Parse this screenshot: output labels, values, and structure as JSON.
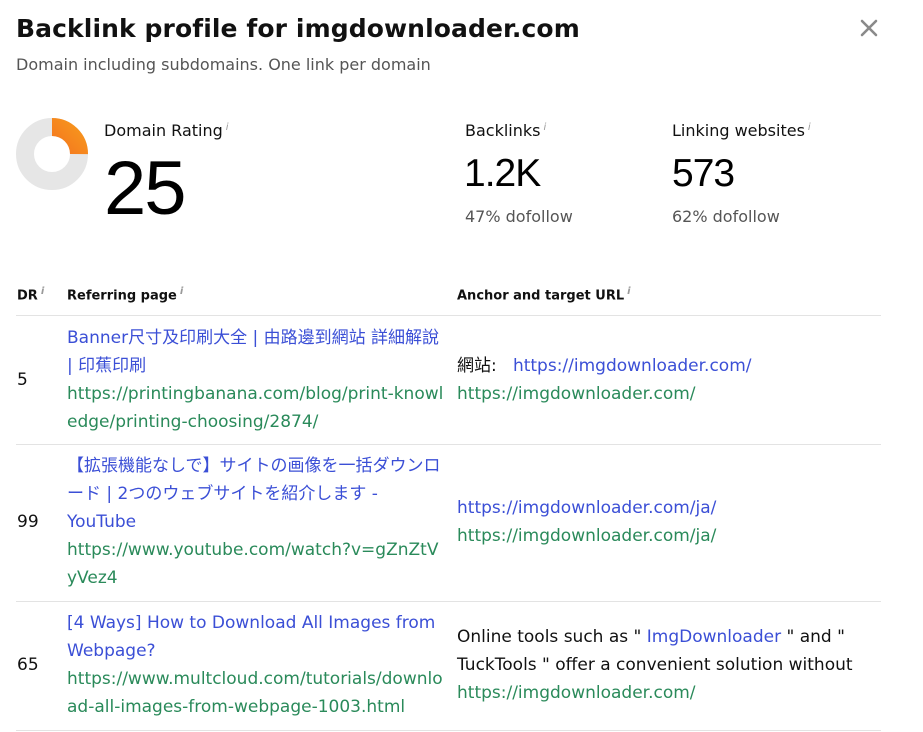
{
  "header": {
    "title": "Backlink profile for imgdownloader.com",
    "subtitle": "Domain including subdomains. One link per domain",
    "close_icon": "close-icon"
  },
  "metrics": {
    "domain_rating": {
      "label": "Domain Rating",
      "value": "25",
      "fraction": 0.25,
      "fill_color": "#f04e23",
      "fill_color_end": "#f7941d",
      "track_color": "#e6e6e6"
    },
    "backlinks": {
      "label": "Backlinks",
      "value": "1.2K",
      "sub": "47% dofollow"
    },
    "linking_websites": {
      "label": "Linking websites",
      "value": "573",
      "sub": "62% dofollow"
    },
    "info_glyph": "i"
  },
  "table": {
    "headers": {
      "dr": "DR",
      "referring_page": "Referring page",
      "anchor": "Anchor and target URL"
    },
    "rows": [
      {
        "dr": "5",
        "title": "Banner尺寸及印刷大全 | 由路邊到網站 詳細解說 | 印蕉印刷",
        "url": "https://printingbanana.com/blog/print-knowledge/printing-choosing/2874/",
        "anchor_prefix": "網站:",
        "anchor_link": "https://imgdownloader.com/",
        "anchor_suffix": "",
        "target": "https://imgdownloader.com/"
      },
      {
        "dr": "99",
        "title": "【拡張機能なしで】サイトの画像を一括ダウンロード | 2つのウェブサイトを紹介します - YouTube",
        "url": "https://www.youtube.com/watch?v=gZnZtVyVez4",
        "anchor_prefix": "",
        "anchor_link": "https://imgdownloader.com/ja/",
        "anchor_suffix": "",
        "target": "https://imgdownloader.com/ja/"
      },
      {
        "dr": "65",
        "title": "[4 Ways] How to Download All Images from Webpage?",
        "url": "https://www.multcloud.com/tutorials/download-all-images-from-webpage-1003.html",
        "anchor_prefix": "Online tools such as \"",
        "anchor_link": "ImgDownloader",
        "anchor_suffix": "\" and \" TuckTools \" offer a convenient solution without",
        "target": "https://imgdownloader.com/"
      }
    ]
  }
}
